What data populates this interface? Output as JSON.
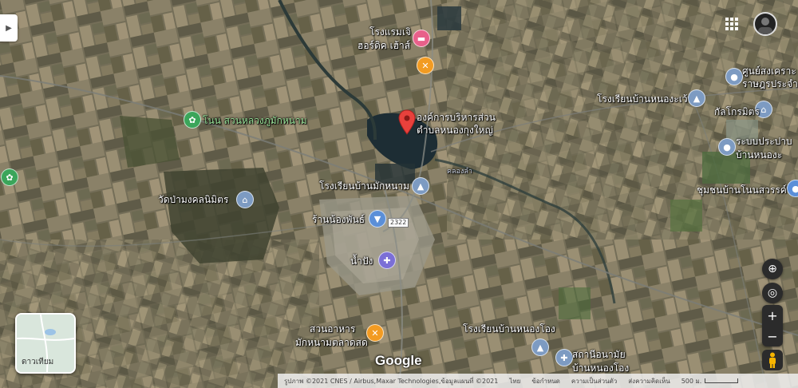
{
  "labels": {
    "hotel": "โรงแรมเจิ",
    "resort": "ฮอร์ดิค เฮ้าส์",
    "sao_line1": "องค์การบริหารส่วน",
    "sao_line2": "ตำบลหนองกุงใหญ่",
    "park": "โนน สวนหลวงภูมักหนาม",
    "school_center": "โรงเรียนบ้านมักหนาม",
    "canal": "คลองลำ",
    "temple": "วัดป่ามงคลนิมิตร",
    "shop": "ร้านน้องพันธ์",
    "road_number": "2322",
    "clinic": "น้ำปัง",
    "garden": "สวนอาหาร",
    "market": "มักหนามตลาดสด",
    "school_south": "โรงเรียนบ้านหนองโอง",
    "health_line1": "สถานีอนามัย",
    "health_line2": "บ้านหนองโอง",
    "school_ne": "โรงเรียนบ้านหนองะเว้",
    "ne_line1": "ศูนย์สงเคราะ",
    "ne_line2": "ราษฎรประจำ",
    "temple_ne": "กัลโกรมิตร",
    "ne_place1": "ระบบประปาบ",
    "ne_place2": "บ้านหนองะ",
    "community": "ชุมชนบ้านโนนสวรรค์"
  },
  "ui": {
    "thumbnail_label": "ดาวเทียม",
    "brand": "Google",
    "footer_credit": "รูปภาพ ©2021 CNES / Airbus,Maxar Technologies,ข้อมูลแผนที่ ©2021",
    "footer_thailand": "ไทย",
    "footer_terms": "ข้อกำหนด",
    "footer_privacy": "ความเป็นส่วนตัว",
    "footer_feedback": "ส่งความคิดเห็น",
    "scale": "500 ม."
  },
  "colors": {
    "selected_pin": "#e8413c",
    "field_dark": "#5e5a46",
    "field_light": "#8d8468",
    "water": "#1d2d34"
  },
  "icons": {
    "hotel_pin": "bed-icon",
    "food_pin": "fork-knife-icon",
    "school_pin": "school-icon",
    "temple_pin": "temple-icon",
    "shop_pin": "shopping-bag-icon",
    "health_pin": "medical-icon",
    "park_pin": "tree-icon"
  }
}
